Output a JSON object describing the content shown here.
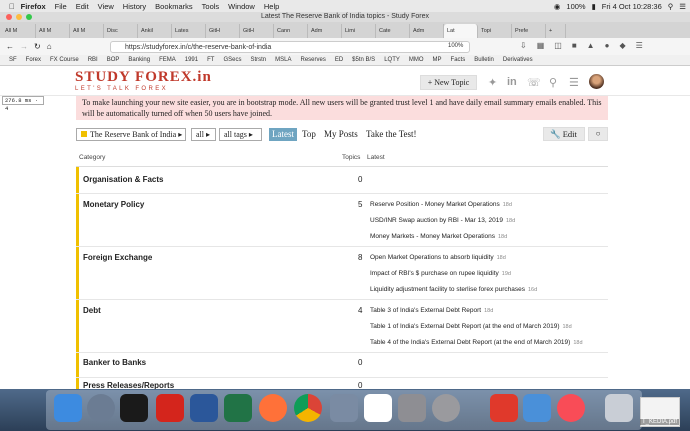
{
  "menubar": {
    "app": "Firefox",
    "items": [
      "File",
      "Edit",
      "View",
      "History",
      "Bookmarks",
      "Tools",
      "Window",
      "Help"
    ],
    "battery": "100%",
    "clock": "Fri 4 Oct  10:28:36"
  },
  "window": {
    "title": "Latest The Reserve Bank of India topics - Study Forex"
  },
  "tabs": [
    "All M",
    "All M",
    "All M",
    "Disc",
    "Ankil",
    "Lates",
    "GitH",
    "GitH",
    "Cann",
    "Adm",
    "Limi",
    "Cate",
    "Adm",
    "Lat",
    "Topi",
    "Prefe"
  ],
  "url": "https://studyforex.in/c/the-reserve-bank-of-india",
  "zoom": "100%",
  "bookmarks": [
    "SF",
    "Forex",
    "FX Course",
    "RBI",
    "BOP",
    "Banking",
    "FEMA",
    "1991",
    "FT",
    "GSecs",
    "Strstn",
    "MSLA",
    "Reserves",
    "ED",
    "$5tn B/S",
    "LQTY",
    "MMO",
    "MP",
    "Facts",
    "Bulletin",
    "Derivatives"
  ],
  "timing": "276.8 ms · 4",
  "site": {
    "logo": "STUDY FOREX.in",
    "tagline": "LET'S TALK FOREX",
    "new_topic": "New Topic"
  },
  "notice": "To make launching your new site easier, you are in bootstrap mode. All new users will be granted trust level 1 and have daily email summary emails enabled. This will be automatically turned off when 50 users have joined.",
  "filters": {
    "category": "The Reserve Bank of India",
    "all": "all",
    "tags": "all tags"
  },
  "nav": [
    "Latest",
    "Top",
    "My Posts",
    "Take the Test!"
  ],
  "edit": "Edit",
  "columns": {
    "category": "Category",
    "topics": "Topics",
    "latest": "Latest"
  },
  "categories": [
    {
      "name": "Organisation & Facts",
      "count": "0",
      "topics": []
    },
    {
      "name": "Monetary Policy",
      "count": "5",
      "topics": [
        {
          "title": "Reserve Position - Money Market Operations",
          "age": "18d"
        },
        {
          "title": "USD/INR Swap auction by RBI - Mar 13, 2019",
          "age": "18d"
        },
        {
          "title": "Money Markets - Money Market Operations",
          "age": "18d"
        }
      ]
    },
    {
      "name": "Foreign Exchange",
      "count": "8",
      "topics": [
        {
          "title": "Open Market Operations to absorb liquidity",
          "age": "18d"
        },
        {
          "title": "Impact of RBI's $ purchase on rupee liquidity",
          "age": "19d"
        },
        {
          "title": "Liquidity adjustment facility to sterlise forex purchases",
          "age": "16d"
        }
      ]
    },
    {
      "name": "Debt",
      "count": "4",
      "topics": [
        {
          "title": "Table 3 of India's External Debt Report",
          "age": "18d"
        },
        {
          "title": "Table 1 of India's External Debt Report (at the end of March 2019)",
          "age": "18d"
        },
        {
          "title": "Table 4 of the India's External Debt Report (at the end of March 2019)",
          "age": "18d"
        }
      ]
    },
    {
      "name": "Banker to Banks",
      "count": "0",
      "topics": []
    },
    {
      "name": "Press Releases/Reports",
      "count": "0",
      "topics": []
    }
  ],
  "desktop": {
    "pdf_label": "T_KEDIA.pdf"
  }
}
